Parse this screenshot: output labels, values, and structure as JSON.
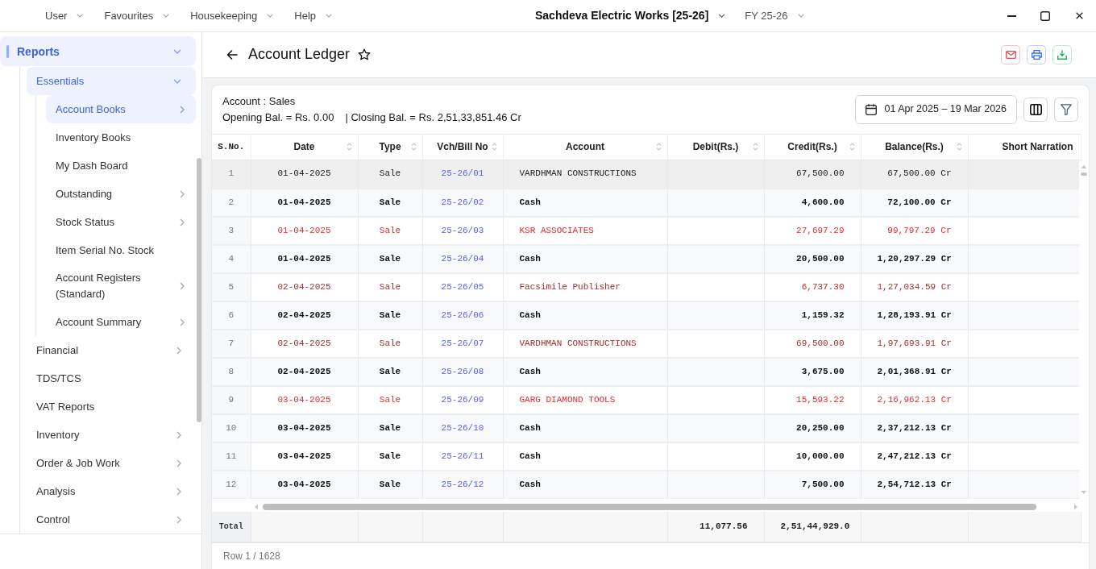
{
  "top_bar": {
    "menus": [
      "User",
      "Favourites",
      "Housekeeping",
      "Help"
    ],
    "company": "Sachdeva Electric Works [25-26]",
    "fiscal_year": "FY 25-26"
  },
  "sidebar": {
    "items": [
      {
        "label": "Reports",
        "expanded": true,
        "selected": true,
        "children": [
          {
            "label": "Essentials",
            "expanded": true,
            "selected": true,
            "children": [
              {
                "label": "Account Books",
                "expanded": false,
                "selected": true
              },
              {
                "label": "Inventory Books",
                "selected": false
              },
              {
                "label": "My Dash Board",
                "selected": false
              },
              {
                "label": "Outstanding",
                "expanded": false,
                "selected": false
              },
              {
                "label": "Stock Status",
                "expanded": false,
                "selected": false
              },
              {
                "label": "Item Serial No. Stock",
                "selected": false
              },
              {
                "label": "Account Registers (Standard)",
                "expanded": false,
                "selected": false
              },
              {
                "label": "Account Summary",
                "expanded": false,
                "selected": false
              }
            ]
          },
          {
            "label": "Financial",
            "expanded": false,
            "selected": false
          },
          {
            "label": "TDS/TCS",
            "selected": false
          },
          {
            "label": "VAT Reports",
            "selected": false
          },
          {
            "label": "Inventory",
            "expanded": false,
            "selected": false
          },
          {
            "label": "Order & Job Work",
            "expanded": false,
            "selected": false
          },
          {
            "label": "Analysis",
            "expanded": false,
            "selected": false
          },
          {
            "label": "Control",
            "expanded": false,
            "selected": false
          }
        ]
      }
    ]
  },
  "page": {
    "title": "Account Ledger",
    "favourite": false
  },
  "report": {
    "account": "Account : Sales",
    "opening_balance": "Opening Bal. = Rs. 0.00",
    "closing_balance": "| Closing Bal. = Rs. 2,51,33,851.46 Cr",
    "date_range": "01 Apr 2025 – 19 Mar 2026"
  },
  "table": {
    "columns": [
      {
        "label": "S.No.",
        "sortable": false
      },
      {
        "label": "Date",
        "sortable": true
      },
      {
        "label": "Type",
        "sortable": true
      },
      {
        "label": "Vch/Bill No",
        "sortable": true
      },
      {
        "label": "Account",
        "sortable": true
      },
      {
        "label": "Debit(Rs.)",
        "sortable": true
      },
      {
        "label": "Credit(Rs.)",
        "sortable": true
      },
      {
        "label": "Balance(Rs.)",
        "sortable": true
      },
      {
        "label": "Short Narration",
        "sortable": false
      }
    ],
    "rows": [
      {
        "sno": "1",
        "date": "01-04-2025",
        "type": "Sale",
        "voucher": "25-26/01",
        "account": "VARDHMAN CONSTRUCTIONS",
        "credit": "67,500.00",
        "balance": "67,500.00 Cr",
        "color": "#222222",
        "bold": false,
        "selected": true
      },
      {
        "sno": "2",
        "date": "01-04-2025",
        "type": "Sale",
        "voucher": "25-26/02",
        "account": "Cash",
        "credit": "4,600.00",
        "balance": "72,100.00 Cr",
        "color": "#111111",
        "bold": true,
        "selected": false
      },
      {
        "sno": "3",
        "date": "01-04-2025",
        "type": "Sale",
        "voucher": "25-26/03",
        "account": "KSR ASSOCIATES",
        "credit": "27,697.29",
        "balance": "99,797.29 Cr",
        "color": "#e02d2d",
        "bold": false,
        "selected": false
      },
      {
        "sno": "4",
        "date": "01-04-2025",
        "type": "Sale",
        "voucher": "25-26/04",
        "account": "Cash",
        "credit": "20,500.00",
        "balance": "1,20,297.29 Cr",
        "color": "#111111",
        "bold": true,
        "selected": false
      },
      {
        "sno": "5",
        "date": "02-04-2025",
        "type": "Sale",
        "voucher": "25-26/05",
        "account": "Facsimile Publisher",
        "credit": "6,737.30",
        "balance": "1,27,034.59 Cr",
        "color": "#a3302a",
        "bold": false,
        "selected": false
      },
      {
        "sno": "6",
        "date": "02-04-2025",
        "type": "Sale",
        "voucher": "25-26/06",
        "account": "Cash",
        "credit": "1,159.32",
        "balance": "1,28,193.91 Cr",
        "color": "#111111",
        "bold": true,
        "selected": false
      },
      {
        "sno": "7",
        "date": "02-04-2025",
        "type": "Sale",
        "voucher": "25-26/07",
        "account": "VARDHMAN CONSTRUCTIONS",
        "credit": "69,500.00",
        "balance": "1,97,693.91 Cr",
        "color": "#a3302a",
        "bold": false,
        "selected": false
      },
      {
        "sno": "8",
        "date": "02-04-2025",
        "type": "Sale",
        "voucher": "25-26/08",
        "account": "Cash",
        "credit": "3,675.00",
        "balance": "2,01,368.91 Cr",
        "color": "#111111",
        "bold": true,
        "selected": false
      },
      {
        "sno": "9",
        "date": "03-04-2025",
        "type": "Sale",
        "voucher": "25-26/09",
        "account": "GARG DIAMOND TOOLS",
        "credit": "15,593.22",
        "balance": "2,16,962.13 Cr",
        "color": "#e02d2d",
        "bold": false,
        "selected": false
      },
      {
        "sno": "10",
        "date": "03-04-2025",
        "type": "Sale",
        "voucher": "25-26/10",
        "account": "Cash",
        "credit": "20,250.00",
        "balance": "2,37,212.13 Cr",
        "color": "#111111",
        "bold": true,
        "selected": false
      },
      {
        "sno": "11",
        "date": "03-04-2025",
        "type": "Sale",
        "voucher": "25-26/11",
        "account": "Cash",
        "credit": "10,000.00",
        "balance": "2,47,212.13 Cr",
        "color": "#111111",
        "bold": true,
        "selected": false
      },
      {
        "sno": "12",
        "date": "03-04-2025",
        "type": "Sale",
        "voucher": "25-26/12",
        "account": "Cash",
        "credit": "7,500.00",
        "balance": "2,54,712.13 Cr",
        "color": "#111111",
        "bold": true,
        "selected": false
      }
    ],
    "totals": {
      "label": "Total",
      "debit": "11,077.56",
      "credit": "2,51,44,929.0"
    }
  },
  "status_bar": {
    "text": "Row 1 / 1628"
  }
}
